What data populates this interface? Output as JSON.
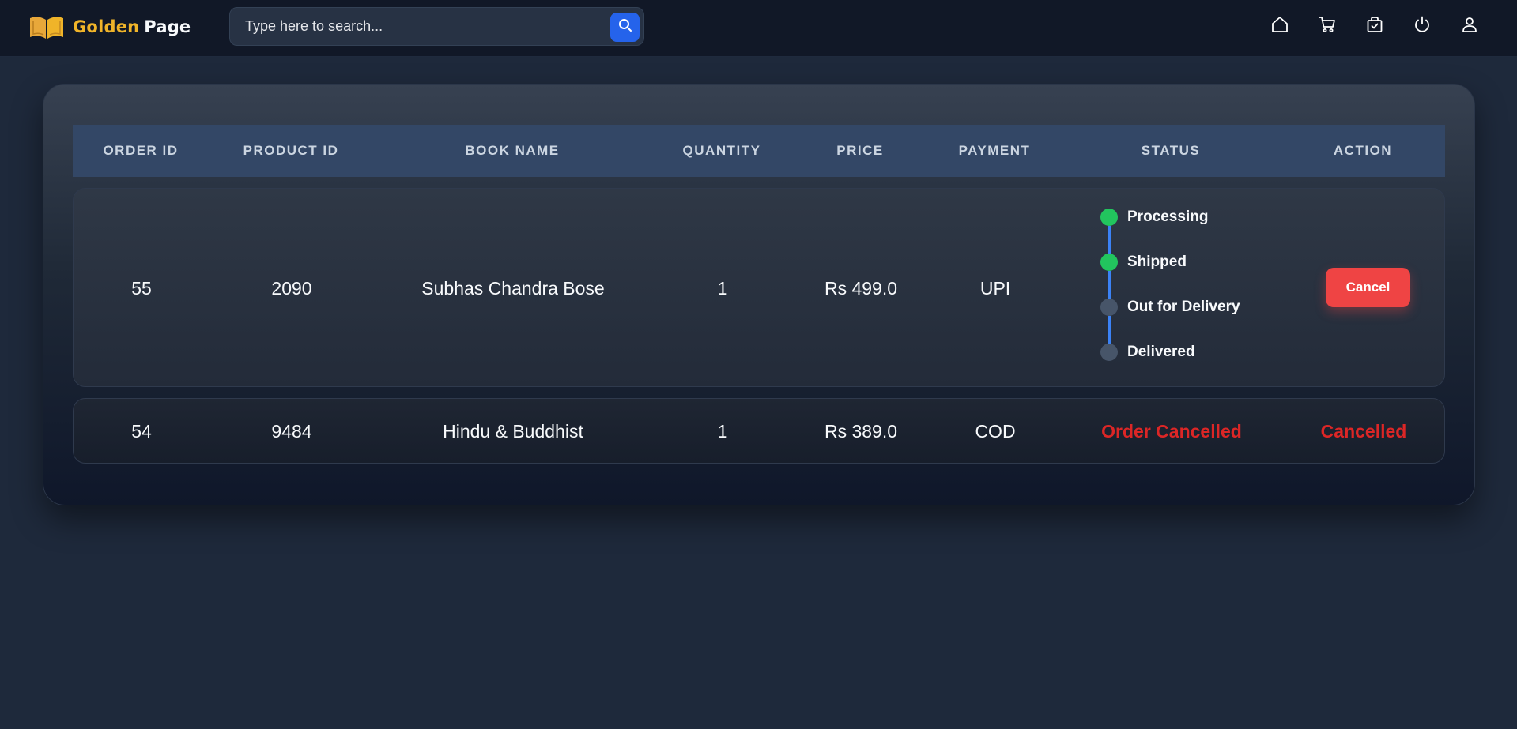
{
  "brand": {
    "name_a": "Golden",
    "name_b": "Page",
    "accent": "#f0b429"
  },
  "search": {
    "placeholder": "Type here to search...",
    "value": "",
    "icon": "search-icon"
  },
  "nav": {
    "icons": [
      "home-icon",
      "cart-icon",
      "orders-bag-icon",
      "power-icon",
      "user-icon"
    ]
  },
  "table": {
    "headers": [
      "ORDER ID",
      "PRODUCT ID",
      "BOOK NAME",
      "QUANTITY",
      "PRICE",
      "PAYMENT",
      "STATUS",
      "ACTION"
    ],
    "rows": [
      {
        "order_id": "55",
        "product_id": "2090",
        "book_name": "Subhas Chandra Bose",
        "quantity": "1",
        "price": "Rs 499.0",
        "payment": "UPI",
        "status_steps": [
          {
            "label": "Processing",
            "done": true
          },
          {
            "label": "Shipped",
            "done": true
          },
          {
            "label": "Out for Delivery",
            "done": false
          },
          {
            "label": "Delivered",
            "done": false
          }
        ],
        "action": "Cancel"
      },
      {
        "order_id": "54",
        "product_id": "9484",
        "book_name": "Hindu & Buddhist",
        "quantity": "1",
        "price": "Rs 389.0",
        "payment": "COD",
        "status": "Order Cancelled",
        "action": "Cancelled"
      }
    ]
  },
  "colors": {
    "done": "#22c55e",
    "pending": "#475569",
    "danger": "#dc2626",
    "primary": "#2563eb"
  }
}
